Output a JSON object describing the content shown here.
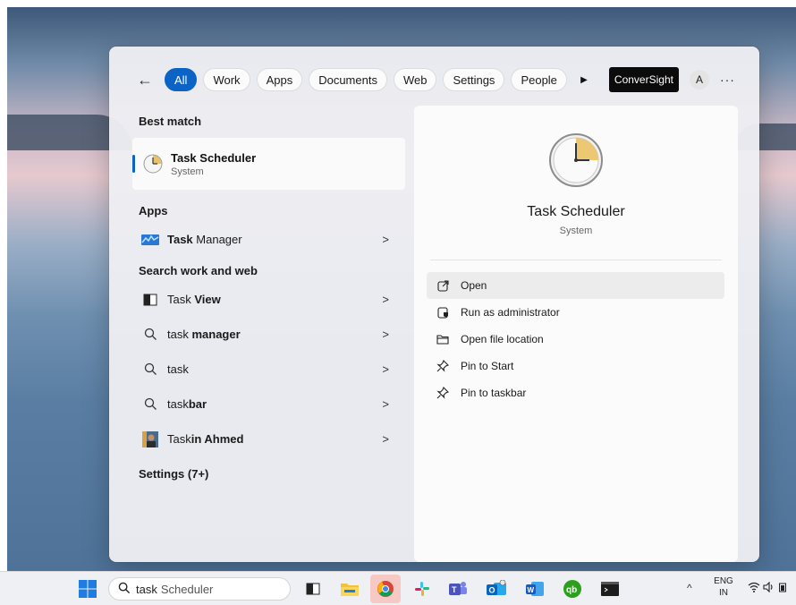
{
  "filters": {
    "back_label": "←",
    "chips": [
      "All",
      "Work",
      "Apps",
      "Documents",
      "Web",
      "Settings",
      "People"
    ],
    "play_label": "▶",
    "org_badge": "ConverSight",
    "avatar_initial": "A",
    "more_label": "···"
  },
  "results": {
    "best_match_heading": "Best match",
    "best_match": {
      "title": "Task Scheduler",
      "subtitle": "System"
    },
    "apps_heading": "Apps",
    "apps": [
      {
        "bold": "Task",
        "rest": " Manager"
      }
    ],
    "web_heading": "Search work and web",
    "web": [
      {
        "plain": "Task ",
        "bold": "View",
        "icon": "task-view-icon"
      },
      {
        "plain": "task ",
        "bold": "manager",
        "icon": "search-icon"
      },
      {
        "plain": "task",
        "bold": "",
        "icon": "search-icon"
      },
      {
        "plain": "task",
        "bold": "bar",
        "icon": "search-icon"
      },
      {
        "plain": "Task",
        "bold": "in Ahmed",
        "icon": "person-avatar-icon"
      }
    ],
    "settings_heading": "Settings (7+)",
    "chevron": ">"
  },
  "detail": {
    "title": "Task Scheduler",
    "subtitle": "System",
    "actions": [
      {
        "label": "Open",
        "icon": "open-external-icon"
      },
      {
        "label": "Run as administrator",
        "icon": "shield-admin-icon"
      },
      {
        "label": "Open file location",
        "icon": "folder-icon"
      },
      {
        "label": "Pin to Start",
        "icon": "pin-icon"
      },
      {
        "label": "Pin to taskbar",
        "icon": "pin-icon"
      }
    ]
  },
  "taskbar": {
    "search_typed": "task",
    "search_suggest": "Scheduler",
    "tray_chevron": "^",
    "lang_line1": "ENG",
    "lang_line2": "IN"
  },
  "colors": {
    "accent": "#0a63c5",
    "panel": "#eeeef3",
    "detail_bg": "#fbfbfb"
  }
}
